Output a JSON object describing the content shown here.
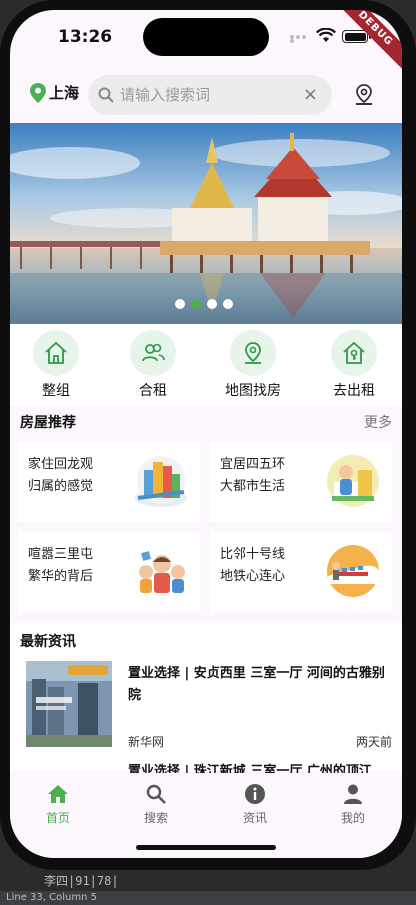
{
  "status": {
    "time": "13:26",
    "debug": "DEBUG"
  },
  "topbar": {
    "city": "上海",
    "search_placeholder": "请输入搜索词",
    "clear": "×"
  },
  "banner": {
    "pages": 4,
    "active_page": 2
  },
  "quick_actions": [
    {
      "label": "整组",
      "icon": "house-icon"
    },
    {
      "label": "合租",
      "icon": "users-icon"
    },
    {
      "label": "地图找房",
      "icon": "map-pin-icon"
    },
    {
      "label": "去出租",
      "icon": "house-key-icon"
    }
  ],
  "recommend": {
    "title": "房屋推荐",
    "more": "更多",
    "cards": [
      {
        "line1": "家住回龙观",
        "line2": "归属的感觉",
        "icon": "city-buildings-icon"
      },
      {
        "line1": "宜居四五环",
        "line2": "大都市生活",
        "icon": "city-life-icon"
      },
      {
        "line1": "喧嚣三里屯",
        "line2": "繁华的背后",
        "icon": "family-icon"
      },
      {
        "line1": "比邻十号线",
        "line2": "地铁心连心",
        "icon": "subway-train-icon"
      }
    ]
  },
  "news": {
    "title": "最新资讯",
    "items": [
      {
        "headline": "置业选择 | 安贞西里 三室一厅 河间的古雅别院",
        "source": "新华网",
        "time": "两天前"
      },
      {
        "headline": "置业选择 | 珠江新城 三室一厅 广州的顶江"
      }
    ]
  },
  "tabs": [
    {
      "label": "首页",
      "icon": "home-icon",
      "active": true
    },
    {
      "label": "搜索",
      "icon": "search-icon",
      "active": false
    },
    {
      "label": "资讯",
      "icon": "info-icon",
      "active": false
    },
    {
      "label": "我的",
      "icon": "person-icon",
      "active": false
    }
  ],
  "editor": {
    "gutter": "李四|91|78|",
    "status": "Line 33, Column 5"
  },
  "colors": {
    "accent": "#4caf50",
    "mint": "#e7f4ea"
  }
}
